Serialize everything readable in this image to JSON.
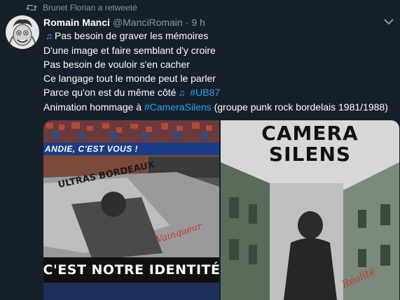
{
  "retweet": {
    "icon": "retweet-icon",
    "text": "Brunet Florian a retweeté"
  },
  "tweet": {
    "author": "Romain Manci",
    "handle": "@ManciRomain",
    "separator": "·",
    "time": "9 h",
    "lines": [
      {
        "prefix_icon": "music-notes-icon",
        "text": "Pas besoin de graver les mémoires"
      },
      {
        "text": "D'une image et faire semblant d'y croire"
      },
      {
        "text": "Pas besoin de vouloir s'en cacher"
      },
      {
        "text": "Ce langage tout le monde peut le parler"
      },
      {
        "text": "Parce qu'on est du même côté",
        "suffix_icon": "music-notes-icon",
        "hashtag": "#UB87"
      },
      {
        "text": "Animation hommage à ",
        "hashtag": "#CameraSilens",
        "rest": " (groupe punk rock bordelais 1981/1988)"
      }
    ]
  },
  "media": {
    "left": {
      "banner_top": "ANDIE, C'EST VOUS !",
      "tifo_text": "ULTRAS BORDEAUX",
      "banner_bottom": "C'EST NOTRE IDENTITÉ",
      "signature": "Vainqueur"
    },
    "right": {
      "title": "CAMERA SILENS",
      "title_line1": "CAMERA",
      "title_line2": "SILENS",
      "signature": "Réalité"
    }
  },
  "colors": {
    "background": "#15202b",
    "muted": "#8899a6",
    "link": "#1da1f2",
    "text": "#ffffff"
  }
}
